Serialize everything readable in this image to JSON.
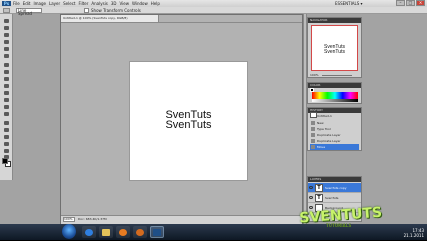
{
  "app": {
    "logo": "Ps",
    "menu": [
      "File",
      "Edit",
      "Image",
      "Layer",
      "Select",
      "Filter",
      "Analysis",
      "3D",
      "View",
      "Window",
      "Help"
    ],
    "workspace_label": "ESSENTIALS ▾",
    "window_buttons": [
      "–",
      "□",
      "×"
    ]
  },
  "options_bar": {
    "mode_value": "Line Spread",
    "checkbox_label": "Show Transform Controls"
  },
  "document": {
    "tab_title": "Untitled-1 @ 100% (SvenTuts copy, RGB/8)",
    "canvas_lines": [
      "SvenTuts",
      "SvenTuts"
    ],
    "zoom": "100%",
    "doc_info": "Doc: 683.4K/1.37M"
  },
  "navigator": {
    "header": "NAVIGATOR",
    "thumb_lines": [
      "SvenTuts",
      "SvenTuts"
    ],
    "zoom": "100%"
  },
  "color_panel": {
    "header": "COLOR"
  },
  "history": {
    "header": "HISTORY",
    "items": [
      "Untitled-1",
      "New",
      "Type Tool",
      "Duplicate Layer",
      "Duplicate Layer",
      "Move"
    ]
  },
  "layers": {
    "header": "LAYERS",
    "items": [
      {
        "name": "SvenTuts copy",
        "selected": true
      },
      {
        "name": "SvenTuts",
        "selected": false
      },
      {
        "name": "Background",
        "selected": false
      }
    ]
  },
  "taskbar": {
    "apps": [
      "Internet Explorer",
      "Windows Explorer",
      "Media Player",
      "Firefox",
      "Photoshop"
    ],
    "clock_time": "17:43",
    "clock_date": "21.1.2011"
  },
  "watermark": {
    "text": "SVENTUTS",
    "sub": "TUTORIALS"
  },
  "icon_names": [
    "ps-logo-icon",
    "move-tool-icon",
    "marquee-tool-icon",
    "lasso-tool-icon",
    "wand-tool-icon",
    "crop-tool-icon",
    "eyedropper-tool-icon",
    "heal-tool-icon",
    "brush-tool-icon",
    "stamp-tool-icon",
    "history-brush-icon",
    "eraser-tool-icon",
    "gradient-tool-icon",
    "blur-tool-icon",
    "dodge-tool-icon",
    "pen-tool-icon",
    "type-tool-icon",
    "path-select-icon",
    "shape-tool-icon",
    "hand-tool-icon",
    "zoom-tool-icon",
    "eye-icon",
    "start-orb-icon"
  ]
}
